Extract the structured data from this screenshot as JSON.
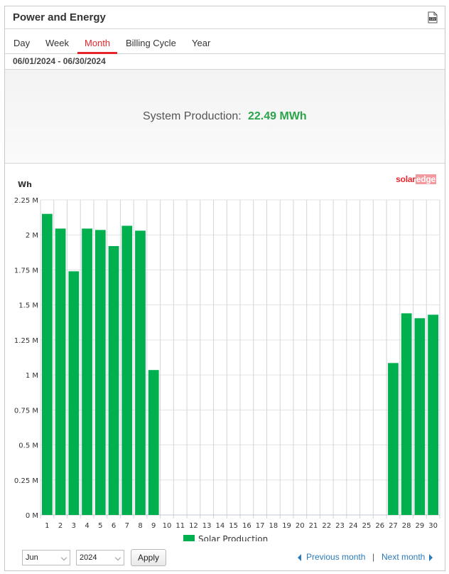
{
  "header": {
    "title": "Power and Energy",
    "csv_icon": "csv-icon"
  },
  "tabs": [
    {
      "label": "Day"
    },
    {
      "label": "Week"
    },
    {
      "label": "Month",
      "active": true
    },
    {
      "label": "Billing Cycle"
    },
    {
      "label": "Year"
    }
  ],
  "date_range": "06/01/2024 - 06/30/2024",
  "summary": {
    "label": "System Production:",
    "value": "22.49 MWh"
  },
  "logo": {
    "solar": "solar",
    "edge": "edge"
  },
  "colors": {
    "accent": "#e4262c",
    "bar": "#00b04f",
    "value_text": "#2aa44a",
    "link": "#2a7ab8"
  },
  "chart_data": {
    "type": "bar",
    "ylabel": "Wh",
    "ylim": [
      0,
      2250000
    ],
    "yticks": [
      {
        "value": 0,
        "label": "0 M"
      },
      {
        "value": 250000,
        "label": "0.25 M"
      },
      {
        "value": 500000,
        "label": "0.5 M"
      },
      {
        "value": 750000,
        "label": "0.75 M"
      },
      {
        "value": 1000000,
        "label": "1 M"
      },
      {
        "value": 1250000,
        "label": "1.25 M"
      },
      {
        "value": 1500000,
        "label": "1.5 M"
      },
      {
        "value": 1750000,
        "label": "1.75 M"
      },
      {
        "value": 2000000,
        "label": "2 M"
      },
      {
        "value": 2250000,
        "label": "2.25 M"
      }
    ],
    "categories": [
      "1",
      "2",
      "3",
      "4",
      "5",
      "6",
      "7",
      "8",
      "9",
      "10",
      "11",
      "12",
      "13",
      "14",
      "15",
      "16",
      "17",
      "18",
      "19",
      "20",
      "21",
      "22",
      "23",
      "24",
      "25",
      "26",
      "27",
      "28",
      "29",
      "30"
    ],
    "series": [
      {
        "name": "Solar Production",
        "values": [
          2150000,
          2045000,
          1740000,
          2045000,
          2035000,
          1920000,
          2065000,
          2030000,
          1035000,
          0,
          0,
          0,
          0,
          0,
          0,
          0,
          0,
          0,
          0,
          0,
          0,
          0,
          0,
          0,
          0,
          0,
          1085000,
          1440000,
          1405000,
          1430000
        ]
      }
    ],
    "grid": true,
    "legend": "bottom-center"
  },
  "controls": {
    "month": "Jun",
    "year": "2024",
    "apply": "Apply",
    "prev": "Previous month",
    "separator": "|",
    "next": "Next month"
  }
}
